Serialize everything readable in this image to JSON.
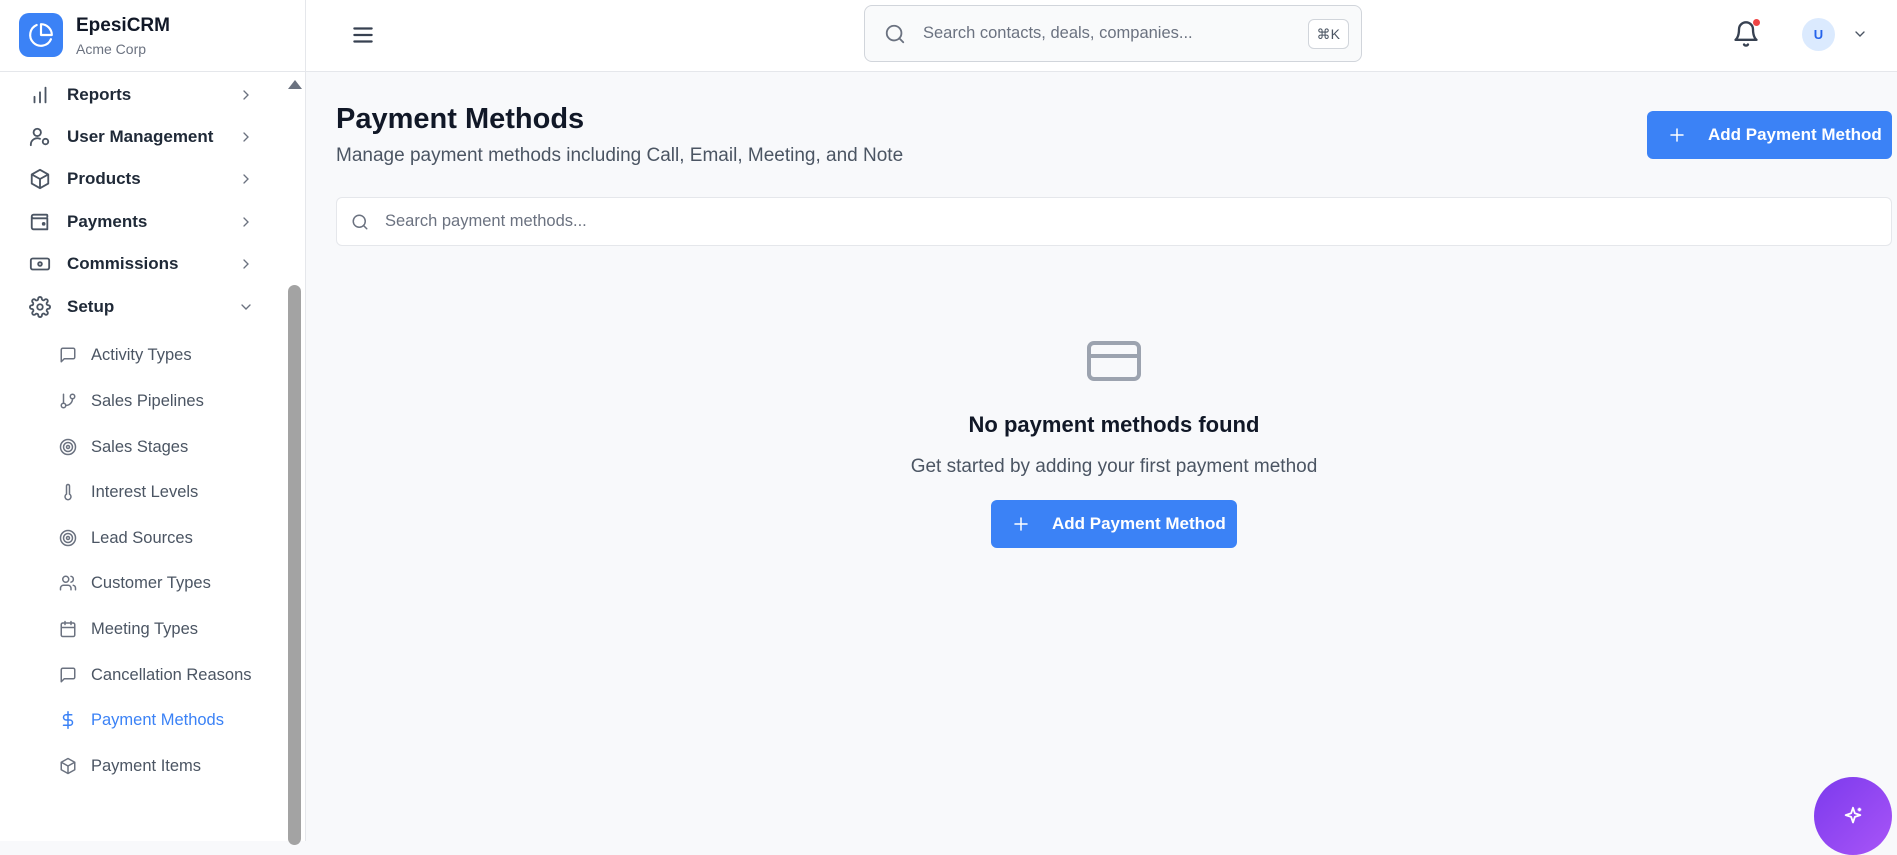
{
  "brand": {
    "name": "EpesiCRM",
    "org": "Acme Corp"
  },
  "topbar": {
    "search_placeholder": "Search contacts, deals, companies...",
    "shortcut": "⌘K",
    "user_initial": "U"
  },
  "sidebar": {
    "items": [
      {
        "label": "Reports",
        "icon": "bar-chart-icon"
      },
      {
        "label": "User Management",
        "icon": "user-gear-icon"
      },
      {
        "label": "Products",
        "icon": "box-icon"
      },
      {
        "label": "Payments",
        "icon": "wallet-icon"
      },
      {
        "label": "Commissions",
        "icon": "banknote-icon"
      },
      {
        "label": "Setup",
        "icon": "gear-icon",
        "expanded": true
      }
    ],
    "setup_items": [
      {
        "label": "Activity Types",
        "icon": "message-square-icon"
      },
      {
        "label": "Sales Pipelines",
        "icon": "git-branch-icon"
      },
      {
        "label": "Sales Stages",
        "icon": "target-icon"
      },
      {
        "label": "Interest Levels",
        "icon": "thermometer-icon"
      },
      {
        "label": "Lead Sources",
        "icon": "target-icon"
      },
      {
        "label": "Customer Types",
        "icon": "users-icon"
      },
      {
        "label": "Meeting Types",
        "icon": "calendar-icon"
      },
      {
        "label": "Cancellation Reasons",
        "icon": "message-square-icon"
      },
      {
        "label": "Payment Methods",
        "icon": "dollar-icon",
        "active": true
      },
      {
        "label": "Payment Items",
        "icon": "box-icon"
      }
    ]
  },
  "main": {
    "title": "Payment Methods",
    "subtitle": "Manage payment methods including Call, Email, Meeting, and Note",
    "add_button": "Add Payment Method",
    "search_placeholder": "Search payment methods...",
    "empty_title": "No payment methods found",
    "empty_subtitle": "Get started by adding your first payment method",
    "empty_button": "Add Payment Method"
  },
  "colors": {
    "accent": "#3b82f6",
    "notification": "#ef4444",
    "fab": "#8b5cf6"
  }
}
